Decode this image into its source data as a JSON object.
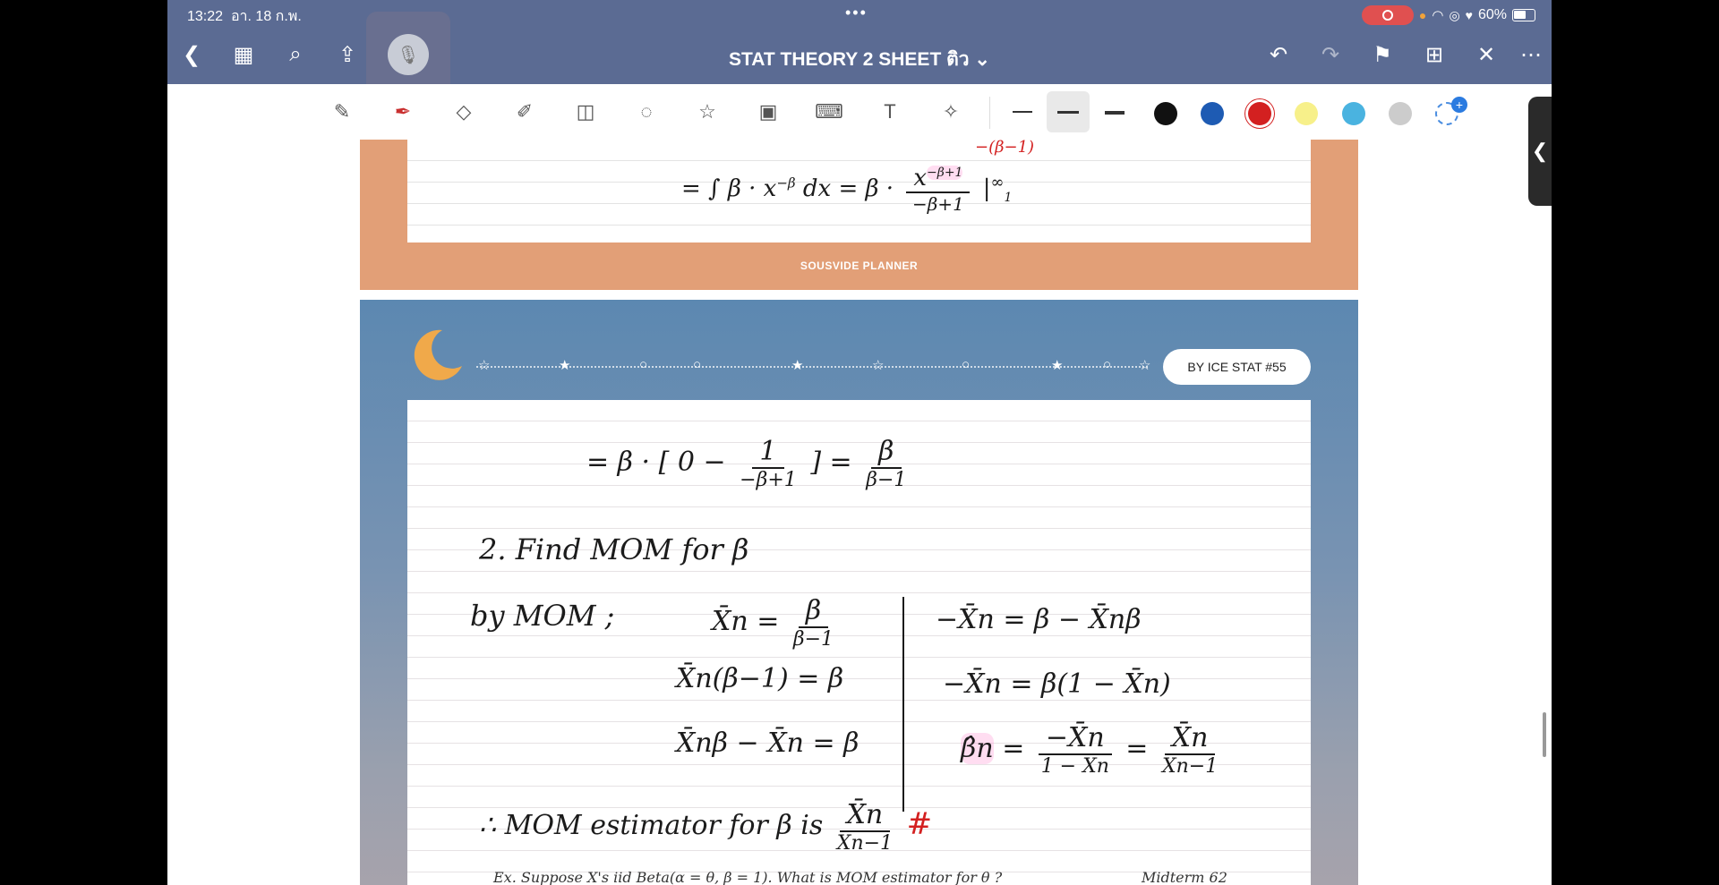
{
  "status": {
    "time": "13:22",
    "date": "อา. 18 ก.พ.",
    "battery": "60%"
  },
  "header": {
    "title": "STAT THEORY 2 SHEET ติว ⌄"
  },
  "toolbar": {
    "swatches": [
      "#111111",
      "#1e5bb3",
      "#d32020",
      "#f7f08a",
      "#4ab3e0",
      "#cccccc"
    ]
  },
  "page1": {
    "footer_label": "SOUSVIDE PLANNER",
    "line1": "= ∫ β · x",
    "line1_sup": "−β",
    "line1_tail": "dx  =  β ·",
    "frac_num": "x",
    "frac_num_sup": "−β+1",
    "frac_den": "−β+1",
    "eval": "|",
    "upper": "∞",
    "lower": "1",
    "red_note": "−(β−1)"
  },
  "page2": {
    "badge": "BY ICE STAT #55",
    "eq1_left": "= β · [ 0 −",
    "eq1_frac_num": "1",
    "eq1_frac_den": "−β+1",
    "eq1_mid": "]  =",
    "eq1_res_num": "β",
    "eq1_res_den": "β−1",
    "step2": "2.  Find MOM for β",
    "by_mom": "by  MOM ;",
    "l1_left": "X̄n =",
    "l1_num": "β",
    "l1_den": "β−1",
    "l2": "X̄n(β−1) = β",
    "l3": "X̄nβ − X̄n = β",
    "r1": "−X̄n = β − X̄nβ",
    "r2": "−X̄n = β(1 − X̄n)",
    "r3_hat": "β̂n",
    "r3_eq": "=",
    "r3_num1": "−X̄n",
    "r3_den1": "1 − X̄n",
    "r3_num2": "X̄n",
    "r3_den2": "X̄n−1",
    "concl": "∴  MOM  estimator  for  β  is",
    "concl_num": "X̄n",
    "concl_den": "X̄n−1",
    "hash": "#",
    "footer_text": "Ex.   Suppose X's  iid  Beta(α = θ, β = 1). What is MOM estimator for θ ?",
    "footer_right": "Midterm 62"
  }
}
